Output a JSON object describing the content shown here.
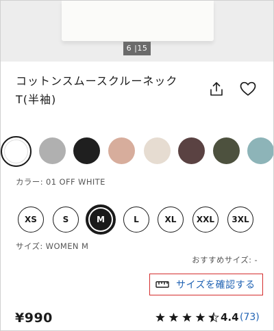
{
  "gallery": {
    "counter": "6 |15"
  },
  "product": {
    "title_line1": "コットンスムースクルーネック",
    "title_line2": "T(半袖)",
    "price": "¥990"
  },
  "actions": {
    "share_icon": "share-icon",
    "favorite_icon": "heart-icon"
  },
  "colors": {
    "swatches": [
      {
        "name": "off-white",
        "hex": "#ffffff",
        "selected": true
      },
      {
        "name": "gray",
        "hex": "#b0b0b0"
      },
      {
        "name": "black",
        "hex": "#1f1f1f"
      },
      {
        "name": "pink-beige",
        "hex": "#d7ad9c"
      },
      {
        "name": "beige",
        "hex": "#e6dcd1"
      },
      {
        "name": "dark-brown",
        "hex": "#5a4242"
      },
      {
        "name": "olive",
        "hex": "#4d513e"
      },
      {
        "name": "light-blue",
        "hex": "#8db4b8"
      }
    ],
    "label": "カラー: 01 OFF WHITE"
  },
  "sizes": {
    "options": [
      "XS",
      "S",
      "M",
      "L",
      "XL",
      "XXL",
      "3XL"
    ],
    "selected": "M",
    "label": "サイズ: WOMEN M",
    "recommended": "おすすめサイズ: -",
    "check_button": "サイズを確認する",
    "check_icon": "ruler-icon"
  },
  "rating": {
    "value": "4.4",
    "count": "(73)",
    "stars": 4.5
  },
  "theme": {
    "accent_link": "#1f62b3",
    "highlight_border": "#d42b2b"
  }
}
